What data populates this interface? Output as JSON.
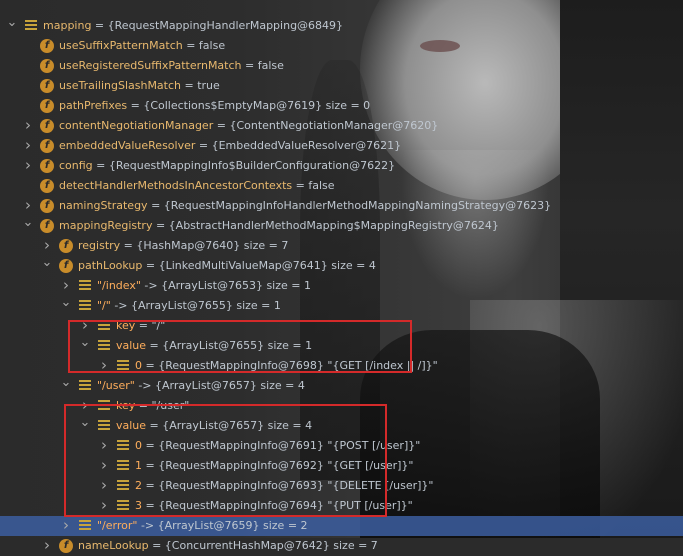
{
  "rows": [
    {
      "depth": 0,
      "arrow": "",
      "icon": "none",
      "name": "",
      "rest": ""
    },
    {
      "depth": 0,
      "arrow": "v",
      "icon": "list",
      "name": "mapping",
      "rest": "= {RequestMappingHandlerMapping@6849}"
    },
    {
      "depth": 1,
      "arrow": "",
      "icon": "field",
      "name": "useSuffixPatternMatch",
      "rest": "= false"
    },
    {
      "depth": 1,
      "arrow": "",
      "icon": "field",
      "name": "useRegisteredSuffixPatternMatch",
      "rest": "= false"
    },
    {
      "depth": 1,
      "arrow": "",
      "icon": "field",
      "name": "useTrailingSlashMatch",
      "rest": "= true"
    },
    {
      "depth": 1,
      "arrow": "",
      "icon": "field",
      "name": "pathPrefixes",
      "rest": "= {Collections$EmptyMap@7619}  size = 0"
    },
    {
      "depth": 1,
      "arrow": ">",
      "icon": "field",
      "name": "contentNegotiationManager",
      "rest": "= {ContentNegotiationManager@7620}"
    },
    {
      "depth": 1,
      "arrow": ">",
      "icon": "field",
      "name": "embeddedValueResolver",
      "rest": "= {EmbeddedValueResolver@7621}"
    },
    {
      "depth": 1,
      "arrow": ">",
      "icon": "field",
      "name": "config",
      "rest": "= {RequestMappingInfo$BuilderConfiguration@7622}"
    },
    {
      "depth": 1,
      "arrow": "",
      "icon": "field",
      "name": "detectHandlerMethodsInAncestorContexts",
      "rest": "= false"
    },
    {
      "depth": 1,
      "arrow": ">",
      "icon": "field",
      "name": "namingStrategy",
      "rest": "= {RequestMappingInfoHandlerMethodMappingNamingStrategy@7623}"
    },
    {
      "depth": 1,
      "arrow": "v",
      "icon": "field",
      "name": "mappingRegistry",
      "rest": "= {AbstractHandlerMethodMapping$MappingRegistry@7624}"
    },
    {
      "depth": 2,
      "arrow": ">",
      "icon": "field",
      "name": "registry",
      "rest": "= {HashMap@7640}  size = 7"
    },
    {
      "depth": 2,
      "arrow": "v",
      "icon": "field",
      "name": "pathLookup",
      "rest": "= {LinkedMultiValueMap@7641}  size = 4"
    },
    {
      "depth": 3,
      "arrow": ">",
      "icon": "list",
      "name": "\"/index\"",
      "rest": "-> {ArrayList@7653}  size = 1"
    },
    {
      "depth": 3,
      "arrow": "v",
      "icon": "list",
      "name": "\"/\"",
      "rest": "-> {ArrayList@7655}  size = 1"
    },
    {
      "depth": 4,
      "arrow": ">",
      "icon": "list",
      "name": "key",
      "rest": "= \"/\""
    },
    {
      "depth": 4,
      "arrow": "v",
      "icon": "list",
      "name": "value",
      "rest": "= {ArrayList@7655}  size = 1"
    },
    {
      "depth": 5,
      "arrow": ">",
      "icon": "list",
      "name": "0",
      "rest": "= {RequestMappingInfo@7698} \"{GET [/index || /]}\""
    },
    {
      "depth": 3,
      "arrow": "v",
      "icon": "list",
      "name": "\"/user\"",
      "rest": "-> {ArrayList@7657}  size = 4"
    },
    {
      "depth": 4,
      "arrow": ">",
      "icon": "list",
      "name": "key",
      "rest": "= \"/user\""
    },
    {
      "depth": 4,
      "arrow": "v",
      "icon": "list",
      "name": "value",
      "rest": "= {ArrayList@7657}  size = 4"
    },
    {
      "depth": 5,
      "arrow": ">",
      "icon": "list",
      "name": "0",
      "rest": "= {RequestMappingInfo@7691} \"{POST [/user]}\""
    },
    {
      "depth": 5,
      "arrow": ">",
      "icon": "list",
      "name": "1",
      "rest": "= {RequestMappingInfo@7692} \"{GET [/user]}\""
    },
    {
      "depth": 5,
      "arrow": ">",
      "icon": "list",
      "name": "2",
      "rest": "= {RequestMappingInfo@7693} \"{DELETE [/user]}\""
    },
    {
      "depth": 5,
      "arrow": ">",
      "icon": "list",
      "name": "3",
      "rest": "= {RequestMappingInfo@7694} \"{PUT [/user]}\""
    },
    {
      "depth": 3,
      "arrow": ">",
      "icon": "list",
      "name": "\"/error\"",
      "rest": "-> {ArrayList@7659}  size = 2",
      "selected": true
    },
    {
      "depth": 2,
      "arrow": ">",
      "icon": "field",
      "name": "nameLookup",
      "rest": "= {ConcurrentHashMap@7642}  size = 7"
    }
  ],
  "highlight_boxes": [
    "value-/",
    "value-/user"
  ]
}
